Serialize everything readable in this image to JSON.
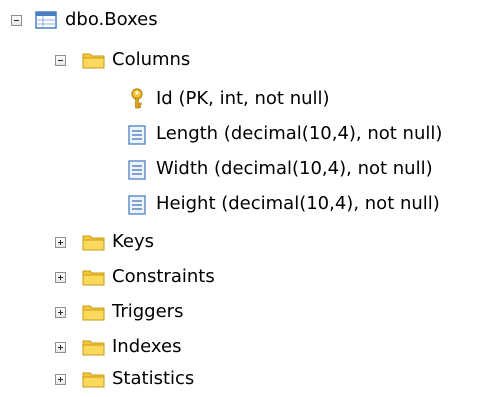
{
  "tree": {
    "root": {
      "label": "dbo.Boxes",
      "icon": "table-icon",
      "expanded": true
    },
    "columns": {
      "label": "Columns",
      "icon": "folder-icon",
      "expanded": true,
      "items": [
        {
          "label": "Id (PK, int, not null)",
          "icon": "primary-key-icon"
        },
        {
          "label": "Length (decimal(10,4), not null)",
          "icon": "column-icon"
        },
        {
          "label": "Width (decimal(10,4), not null)",
          "icon": "column-icon"
        },
        {
          "label": "Height (decimal(10,4), not null)",
          "icon": "column-icon"
        }
      ]
    },
    "folders": [
      {
        "label": "Keys",
        "icon": "folder-icon",
        "expanded": false
      },
      {
        "label": "Constraints",
        "icon": "folder-icon",
        "expanded": false
      },
      {
        "label": "Triggers",
        "icon": "folder-icon",
        "expanded": false
      },
      {
        "label": "Indexes",
        "icon": "folder-icon",
        "expanded": false
      },
      {
        "label": "Statistics",
        "icon": "folder-icon",
        "expanded": false
      }
    ]
  },
  "colors": {
    "folder": "#f5c93a",
    "table_blue": "#4a7fc1",
    "key_gold": "#e0a21a"
  }
}
